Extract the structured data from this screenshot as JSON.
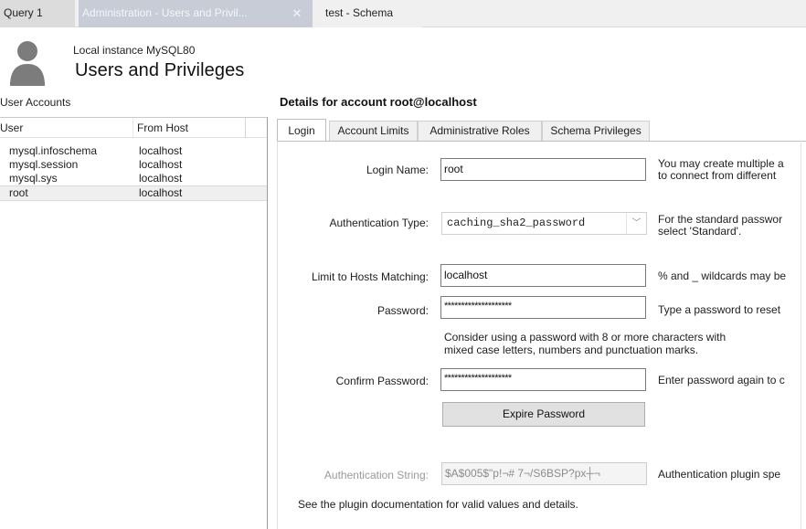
{
  "doc_tabs": [
    {
      "label": "Query 1"
    },
    {
      "label": "Administration - Users and Privil..."
    },
    {
      "label": "test - Schema"
    }
  ],
  "header": {
    "instance": "Local instance MySQL80",
    "title": "Users and Privileges"
  },
  "accounts": {
    "section_label": "User Accounts",
    "columns": [
      "User",
      "From Host"
    ],
    "rows": [
      {
        "user": "mysql.infoschema",
        "host": "localhost"
      },
      {
        "user": "mysql.session",
        "host": "localhost"
      },
      {
        "user": "mysql.sys",
        "host": "localhost"
      },
      {
        "user": "root",
        "host": "localhost"
      }
    ],
    "selected_index": 3
  },
  "details": {
    "title": "Details for account root@localhost",
    "tabs": [
      "Login",
      "Account Limits",
      "Administrative Roles",
      "Schema Privileges"
    ],
    "active_tab": "Login",
    "login_name": {
      "label": "Login Name:",
      "value": "root",
      "desc": [
        "You may create multiple a",
        "to connect from different"
      ]
    },
    "auth_type": {
      "label": "Authentication Type:",
      "value": "caching_sha2_password",
      "desc": [
        "For the standard passwor",
        "select 'Standard'."
      ]
    },
    "hosts": {
      "label": "Limit to Hosts Matching:",
      "value": "localhost",
      "desc": "% and _ wildcards may be"
    },
    "password": {
      "label": "Password:",
      "value": "********************",
      "desc": "Type a password to reset"
    },
    "password_hint": [
      "Consider using a password with 8 or more characters with",
      "mixed case letters, numbers and punctuation marks."
    ],
    "confirm": {
      "label": "Confirm Password:",
      "value": "********************",
      "desc": "Enter password again to c"
    },
    "expire_button": "Expire Password",
    "auth_string": {
      "label": "Authentication String:",
      "value": "$A$005$\"p!¬#        7¬/S6BSP?px┼¬",
      "desc": "Authentication plugin spe"
    },
    "footnote": "See the plugin documentation for valid values and details."
  }
}
